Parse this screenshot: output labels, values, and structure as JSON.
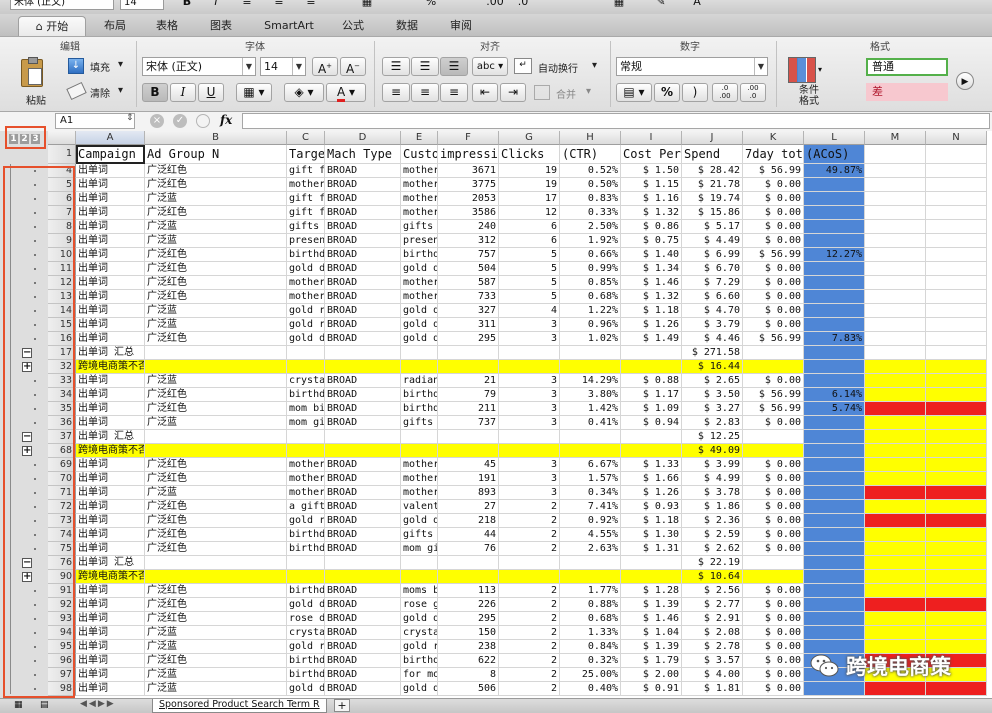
{
  "toolbar": {
    "font_name": "宋体 (正文)",
    "font_size": "14",
    "bold": "B",
    "italic": "I"
  },
  "tabs": [
    "开始",
    "布局",
    "表格",
    "图表",
    "SmartArt",
    "公式",
    "数据",
    "审阅"
  ],
  "ribbon": {
    "groups": {
      "edit": "编辑",
      "font": "字体",
      "align": "对齐",
      "number": "数字",
      "format": "格式"
    },
    "paste": "粘贴",
    "fill": "填充",
    "clear": "清除",
    "font_name": "宋体 (正文)",
    "font_size": "14",
    "wrap": "自动换行",
    "merge": "合并",
    "number_format": "常规",
    "abc": "abc",
    "percent": "%",
    "comma": ")",
    "dec_inc": ".0\n.00",
    "dec_dec": ".00\n.0",
    "cond_format": "条件格式",
    "style_normal": "普通",
    "style_bad": "差"
  },
  "formula_bar": {
    "name_box": "A1",
    "fx": "fx",
    "content": ""
  },
  "outline_levels": [
    "1",
    "2",
    "3"
  ],
  "columns": [
    "A",
    "B",
    "C",
    "D",
    "E",
    "F",
    "G",
    "H",
    "I",
    "J",
    "K",
    "L",
    "M",
    "N"
  ],
  "header_row": {
    "num": "1",
    "cells": [
      "Campaign name",
      "Ad Group N",
      "Targe",
      "Mach Type",
      "Custo",
      "impressi",
      "Clicks",
      "(CTR)",
      "Cost Per",
      "Spend",
      "7day tot",
      "(ACoS)",
      "",
      ""
    ]
  },
  "rows": [
    {
      "n": "4",
      "t": "d",
      "c": [
        "出单词",
        "广泛红色",
        "gift f",
        "BROAD",
        "mother",
        "3671",
        "19",
        "0.52%",
        "$ 1.50",
        "$ 28.42",
        "$ 56.99",
        "49.87%"
      ]
    },
    {
      "n": "5",
      "t": "d",
      "c": [
        "出单词",
        "广泛红色",
        "mother",
        "BROAD",
        "mother",
        "3775",
        "19",
        "0.50%",
        "$ 1.15",
        "$ 21.78",
        "$ 0.00",
        ""
      ]
    },
    {
      "n": "6",
      "t": "d",
      "c": [
        "出单词",
        "广泛蓝",
        "gift f",
        "BROAD",
        "mother",
        "2053",
        "17",
        "0.83%",
        "$ 1.16",
        "$ 19.74",
        "$ 0.00",
        ""
      ]
    },
    {
      "n": "7",
      "t": "d",
      "c": [
        "出单词",
        "广泛红色",
        "gift f",
        "BROAD",
        "mother",
        "3586",
        "12",
        "0.33%",
        "$ 1.32",
        "$ 15.86",
        "$ 0.00",
        ""
      ]
    },
    {
      "n": "8",
      "t": "d",
      "c": [
        "出单词",
        "广泛蓝",
        "gifts",
        "BROAD",
        "gifts",
        "240",
        "6",
        "2.50%",
        "$ 0.86",
        "$ 5.17",
        "$ 0.00",
        ""
      ]
    },
    {
      "n": "9",
      "t": "d",
      "c": [
        "出单词",
        "广泛蓝",
        "presen",
        "BROAD",
        "presen",
        "312",
        "6",
        "1.92%",
        "$ 0.75",
        "$ 4.49",
        "$ 0.00",
        ""
      ]
    },
    {
      "n": "10",
      "t": "d",
      "c": [
        "出单词",
        "广泛红色",
        "birthd",
        "BROAD",
        "birthd",
        "757",
        "5",
        "0.66%",
        "$ 1.40",
        "$ 6.99",
        "$ 56.99",
        "12.27%"
      ]
    },
    {
      "n": "11",
      "t": "d",
      "c": [
        "出单词",
        "广泛红色",
        "gold d",
        "BROAD",
        "gold d",
        "504",
        "5",
        "0.99%",
        "$ 1.34",
        "$ 6.70",
        "$ 0.00",
        ""
      ]
    },
    {
      "n": "12",
      "t": "d",
      "c": [
        "出单词",
        "广泛红色",
        "mother",
        "BROAD",
        "mother",
        "587",
        "5",
        "0.85%",
        "$ 1.46",
        "$ 7.29",
        "$ 0.00",
        ""
      ]
    },
    {
      "n": "13",
      "t": "d",
      "c": [
        "出单词",
        "广泛红色",
        "mother",
        "BROAD",
        "mother",
        "733",
        "5",
        "0.68%",
        "$ 1.32",
        "$ 6.60",
        "$ 0.00",
        ""
      ]
    },
    {
      "n": "14",
      "t": "d",
      "c": [
        "出单词",
        "广泛蓝",
        "gold r",
        "BROAD",
        "gold d",
        "327",
        "4",
        "1.22%",
        "$ 1.18",
        "$ 4.70",
        "$ 0.00",
        ""
      ]
    },
    {
      "n": "15",
      "t": "d",
      "c": [
        "出单词",
        "广泛蓝",
        "gold r",
        "BROAD",
        "gold d",
        "311",
        "3",
        "0.96%",
        "$ 1.26",
        "$ 3.79",
        "$ 0.00",
        ""
      ]
    },
    {
      "n": "16",
      "t": "d",
      "c": [
        "出单词",
        "广泛红色",
        "gold d",
        "BROAD",
        "gold d",
        "295",
        "3",
        "1.02%",
        "$ 1.49",
        "$ 4.46",
        "$ 56.99",
        "7.83%"
      ]
    },
    {
      "n": "17",
      "t": "s",
      "ob": "−",
      "c": [
        "出单词 汇总",
        "",
        "",
        "",
        "",
        "",
        "",
        "",
        "",
        "$ 271.58",
        "",
        ""
      ]
    },
    {
      "n": "32",
      "t": "y",
      "ob": "+",
      "c": [
        "跨境电商策不否定自动 汇总",
        "",
        "",
        "",
        "",
        "",
        "",
        "",
        "",
        "$ 16.44",
        "",
        ""
      ]
    },
    {
      "n": "33",
      "t": "d",
      "c": [
        "出单词",
        "广泛蓝",
        "crysta",
        "BROAD",
        "radian",
        "21",
        "3",
        "14.29%",
        "$ 0.88",
        "$ 2.65",
        "$ 0.00",
        ""
      ]
    },
    {
      "n": "34",
      "t": "d",
      "c": [
        "出单词",
        "广泛红色",
        "birthd",
        "BROAD",
        "birthd",
        "79",
        "3",
        "3.80%",
        "$ 1.17",
        "$ 3.50",
        "$ 56.99",
        "6.14%"
      ]
    },
    {
      "n": "35",
      "t": "d",
      "c": [
        "出单词",
        "广泛红色",
        "mom bi",
        "BROAD",
        "birthd",
        "211",
        "3",
        "1.42%",
        "$ 1.09",
        "$ 3.27",
        "$ 56.99",
        "5.74%"
      ]
    },
    {
      "n": "36",
      "t": "d",
      "c": [
        "出单词",
        "广泛蓝",
        "mom gi",
        "BROAD",
        "gifts",
        "737",
        "3",
        "0.41%",
        "$ 0.94",
        "$ 2.83",
        "$ 0.00",
        ""
      ]
    },
    {
      "n": "37",
      "t": "s",
      "ob": "−",
      "c": [
        "出单词 汇总",
        "",
        "",
        "",
        "",
        "",
        "",
        "",
        "",
        "$ 12.25",
        "",
        ""
      ]
    },
    {
      "n": "68",
      "t": "y",
      "ob": "+",
      "c": [
        "跨境电商策不否定自动 汇总",
        "",
        "",
        "",
        "",
        "",
        "",
        "",
        "",
        "$ 49.09",
        "",
        ""
      ]
    },
    {
      "n": "69",
      "t": "d",
      "c": [
        "出单词",
        "广泛红色",
        "mother",
        "BROAD",
        "mother",
        "45",
        "3",
        "6.67%",
        "$ 1.33",
        "$ 3.99",
        "$ 0.00",
        ""
      ]
    },
    {
      "n": "70",
      "t": "d",
      "c": [
        "出单词",
        "广泛红色",
        "mother",
        "BROAD",
        "mother",
        "191",
        "3",
        "1.57%",
        "$ 1.66",
        "$ 4.99",
        "$ 0.00",
        ""
      ]
    },
    {
      "n": "71",
      "t": "d",
      "c": [
        "出单词",
        "广泛蓝",
        "mother",
        "BROAD",
        "mother",
        "893",
        "3",
        "0.34%",
        "$ 1.26",
        "$ 3.78",
        "$ 0.00",
        ""
      ]
    },
    {
      "n": "72",
      "t": "d",
      "c": [
        "出单词",
        "广泛红色",
        "a gift",
        "BROAD",
        "valent",
        "27",
        "2",
        "7.41%",
        "$ 0.93",
        "$ 1.86",
        "$ 0.00",
        ""
      ]
    },
    {
      "n": "73",
      "t": "d",
      "c": [
        "出单词",
        "广泛红色",
        "gold r",
        "BROAD",
        "gold d",
        "218",
        "2",
        "0.92%",
        "$ 1.18",
        "$ 2.36",
        "$ 0.00",
        ""
      ]
    },
    {
      "n": "74",
      "t": "d",
      "c": [
        "出单词",
        "广泛红色",
        "birthd",
        "BROAD",
        "gifts",
        "44",
        "2",
        "4.55%",
        "$ 1.30",
        "$ 2.59",
        "$ 0.00",
        ""
      ]
    },
    {
      "n": "75",
      "t": "d",
      "c": [
        "出单词",
        "广泛红色",
        "birthd",
        "BROAD",
        "mom gi",
        "76",
        "2",
        "2.63%",
        "$ 1.31",
        "$ 2.62",
        "$ 0.00",
        ""
      ]
    },
    {
      "n": "76",
      "t": "s",
      "ob": "−",
      "c": [
        "出单词 汇总",
        "",
        "",
        "",
        "",
        "",
        "",
        "",
        "",
        "$ 22.19",
        "",
        ""
      ]
    },
    {
      "n": "90",
      "t": "y",
      "ob": "+",
      "c": [
        "跨境电商策不否定自动 汇总",
        "",
        "",
        "",
        "",
        "",
        "",
        "",
        "",
        "$ 10.64",
        "",
        ""
      ]
    },
    {
      "n": "91",
      "t": "d",
      "c": [
        "出单词",
        "广泛红色",
        "birthd",
        "BROAD",
        "moms b",
        "113",
        "2",
        "1.77%",
        "$ 1.28",
        "$ 2.56",
        "$ 0.00",
        ""
      ]
    },
    {
      "n": "92",
      "t": "d",
      "c": [
        "出单词",
        "广泛红色",
        "gold d",
        "BROAD",
        "rose g",
        "226",
        "2",
        "0.88%",
        "$ 1.39",
        "$ 2.77",
        "$ 0.00",
        ""
      ]
    },
    {
      "n": "93",
      "t": "d",
      "c": [
        "出单词",
        "广泛红色",
        "rose d",
        "BROAD",
        "gold d",
        "295",
        "2",
        "0.68%",
        "$ 1.46",
        "$ 2.91",
        "$ 0.00",
        ""
      ]
    },
    {
      "n": "94",
      "t": "d",
      "c": [
        "出单词",
        "广泛蓝",
        "crysta",
        "BROAD",
        "crysta",
        "150",
        "2",
        "1.33%",
        "$ 1.04",
        "$ 2.08",
        "$ 0.00",
        ""
      ]
    },
    {
      "n": "95",
      "t": "d",
      "c": [
        "出单词",
        "广泛蓝",
        "gold r",
        "BROAD",
        "gold r",
        "238",
        "2",
        "0.84%",
        "$ 1.39",
        "$ 2.78",
        "$ 0.00",
        ""
      ]
    },
    {
      "n": "96",
      "t": "d",
      "c": [
        "出单词",
        "广泛红色",
        "birthd",
        "BROAD",
        "birthd",
        "622",
        "2",
        "0.32%",
        "$ 1.79",
        "$ 3.57",
        "$ 0.00",
        ""
      ]
    },
    {
      "n": "97",
      "t": "d",
      "c": [
        "出单词",
        "广泛蓝",
        "birthd",
        "BROAD",
        "for mo",
        "8",
        "2",
        "25.00%",
        "$ 2.00",
        "$ 4.00",
        "$ 0.00",
        ""
      ]
    },
    {
      "n": "98",
      "t": "d",
      "c": [
        "出单词",
        "广泛蓝",
        "gold d",
        "BROAD",
        "gold d",
        "506",
        "2",
        "0.40%",
        "$ 0.91",
        "$ 1.81",
        "$ 0.00",
        ""
      ]
    }
  ],
  "sheet_tab": "Sponsored Product Search Term R",
  "add_sheet": "+",
  "watermark": "跨境电商策",
  "colors": {
    "acos_blue": "#4f86d6",
    "yellow": "#ffff00",
    "red": "#ee1f1f",
    "annotation": "#e6502c"
  }
}
